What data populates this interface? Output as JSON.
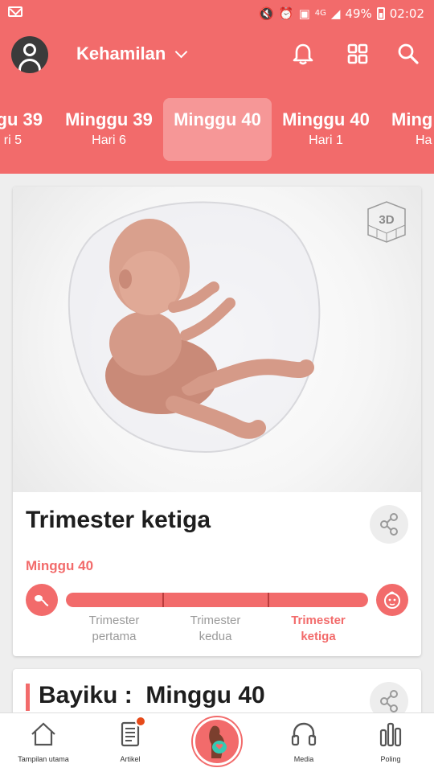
{
  "status_bar": {
    "battery": "49%",
    "time": "02:02",
    "network": "4G"
  },
  "header": {
    "title": "Kehamilan"
  },
  "tabs": [
    {
      "week": "gu 39",
      "day": "ri 5"
    },
    {
      "week": "Minggu 39",
      "day": "Hari 6"
    },
    {
      "week": "Minggu 40",
      "day": ""
    },
    {
      "week": "Minggu 40",
      "day": "Hari 1"
    },
    {
      "week": "Ming",
      "day": "Ha"
    }
  ],
  "card1": {
    "badge": "3D",
    "title": "Trimester ketiga",
    "week_label": "Minggu 40",
    "progress": 1.0,
    "trimesters": [
      {
        "line1": "Trimester",
        "line2": "pertama"
      },
      {
        "line1": "Trimester",
        "line2": "kedua"
      },
      {
        "line1": "Trimester",
        "line2": "ketiga"
      }
    ]
  },
  "card2": {
    "title": "Bayiku :  Minggu 40"
  },
  "bottom_nav": [
    {
      "label": "Tampilan utama",
      "icon": "home-icon"
    },
    {
      "label": "Artikel",
      "icon": "article-icon"
    },
    {
      "label": "",
      "icon": "pregnancy-icon"
    },
    {
      "label": "Media",
      "icon": "headphones-icon"
    },
    {
      "label": "Poling",
      "icon": "poll-icon"
    }
  ],
  "colors": {
    "accent": "#f26b6b"
  }
}
